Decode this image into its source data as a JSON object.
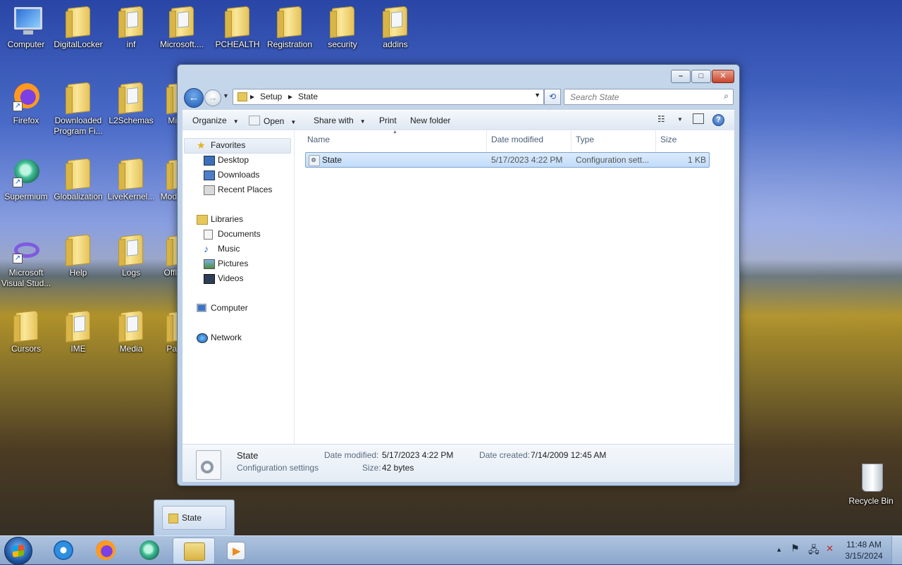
{
  "desktop": {
    "icons": [
      {
        "label": "Computer",
        "kind": "computer"
      },
      {
        "label": "DigitalLocker",
        "kind": "folder"
      },
      {
        "label": "inf",
        "kind": "folder"
      },
      {
        "label": "Microsoft....",
        "kind": "folder"
      },
      {
        "label": "PCHEALTH",
        "kind": "folder"
      },
      {
        "label": "Registration",
        "kind": "folder"
      },
      {
        "label": "security",
        "kind": "folder"
      },
      {
        "label": "addins",
        "kind": "folder"
      },
      {
        "label": "Firefox",
        "kind": "firefox"
      },
      {
        "label": "Downloaded Program Fi...",
        "kind": "folder"
      },
      {
        "label": "L2Schemas",
        "kind": "folder"
      },
      {
        "label": "Mi",
        "kind": "folder"
      },
      {
        "label": "Supermium",
        "kind": "supermium"
      },
      {
        "label": "Globalization",
        "kind": "folder"
      },
      {
        "label": "LiveKernel...",
        "kind": "folder"
      },
      {
        "label": "Mod",
        "kind": "folder"
      },
      {
        "label": "Microsoft Visual Stud...",
        "kind": "vs"
      },
      {
        "label": "Help",
        "kind": "folder"
      },
      {
        "label": "Logs",
        "kind": "folder"
      },
      {
        "label": "Offl",
        "kind": "folder"
      },
      {
        "label": "Cursors",
        "kind": "folder"
      },
      {
        "label": "IME",
        "kind": "folder"
      },
      {
        "label": "Media",
        "kind": "folder"
      },
      {
        "label": "Pa",
        "kind": "folder"
      }
    ],
    "recycle_bin": "Recycle Bin"
  },
  "window": {
    "breadcrumb": [
      "Setup",
      "State"
    ],
    "search_placeholder": "Search State",
    "toolbar": {
      "organize": "Organize",
      "open": "Open",
      "share_with": "Share with",
      "print": "Print",
      "new_folder": "New folder"
    },
    "nav": {
      "favorites": "Favorites",
      "desktop": "Desktop",
      "downloads": "Downloads",
      "recent_places": "Recent Places",
      "libraries": "Libraries",
      "documents": "Documents",
      "music": "Music",
      "pictures": "Pictures",
      "videos": "Videos",
      "computer": "Computer",
      "network": "Network"
    },
    "columns": {
      "name": "Name",
      "date_modified": "Date modified",
      "type": "Type",
      "size": "Size"
    },
    "files": [
      {
        "name": "State",
        "date_modified": "5/17/2023 4:22 PM",
        "type": "Configuration sett...",
        "size": "1 KB"
      }
    ],
    "details": {
      "name": "State",
      "type": "Configuration settings",
      "date_modified_label": "Date modified:",
      "date_modified": "5/17/2023 4:22 PM",
      "size_label": "Size:",
      "size": "42 bytes",
      "date_created_label": "Date created:",
      "date_created": "7/14/2009 12:45 AM"
    }
  },
  "taskbar": {
    "thumbnail_label": "State",
    "clock_time": "11:48 AM",
    "clock_date": "3/15/2024"
  }
}
